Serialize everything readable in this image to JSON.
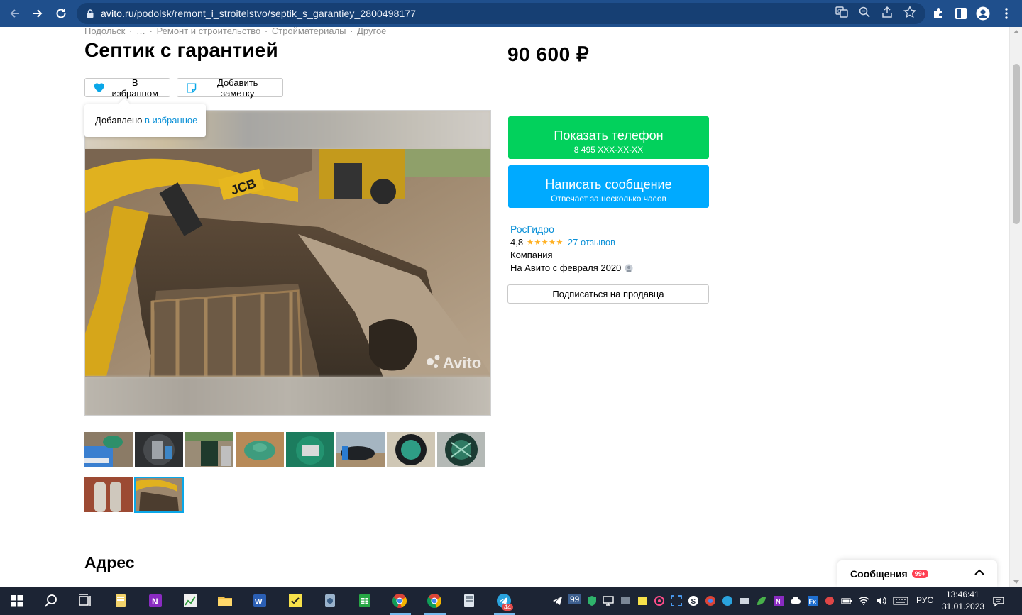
{
  "browser": {
    "url_host": "avito.ru",
    "url_path": "/podolsk/remont_i_stroitelstvo/septik_s_garantiey_2800498177"
  },
  "page": {
    "breadcrumbs": [
      "Подольск",
      "·",
      "…",
      "·",
      "Ремонт и строительство",
      "·",
      "Стройматериалы",
      "·",
      "Другое"
    ],
    "title": "Септик с гарантией",
    "price": "90 600 ₽",
    "favorite_label": "В избранном",
    "note_label": "Добавить заметку",
    "tooltip_text": "Добавлено ",
    "tooltip_link": "в избранное",
    "watermark": "Avito"
  },
  "contact": {
    "show_phone_label": "Показать телефон",
    "phone_masked": "8 495 XXX-XX-XX",
    "message_label": "Написать сообщение",
    "message_sub": "Отвечает за несколько часов"
  },
  "seller": {
    "name": "РосГидро",
    "rating": "4,8",
    "stars": "★★★★★",
    "reviews": "27 отзывов",
    "type": "Компания",
    "since": "На Авито с февраля 2020",
    "subscribe_label": "Подписаться на продавца"
  },
  "address": {
    "heading": "Адрес"
  },
  "messages_widget": {
    "label": "Сообщения",
    "badge": "99+"
  },
  "taskbar": {
    "language": "РУС",
    "time": "13:46:41",
    "date": "31.01.2023",
    "telegram_badge": "44",
    "tray_badge": "99"
  },
  "colors": {
    "chrome": "#1f4f8c",
    "green_button": "#02d15c",
    "blue_button": "#00aaff",
    "link": "#0a90d7",
    "stars": "#ffb021",
    "taskbar": "#1c2434"
  }
}
